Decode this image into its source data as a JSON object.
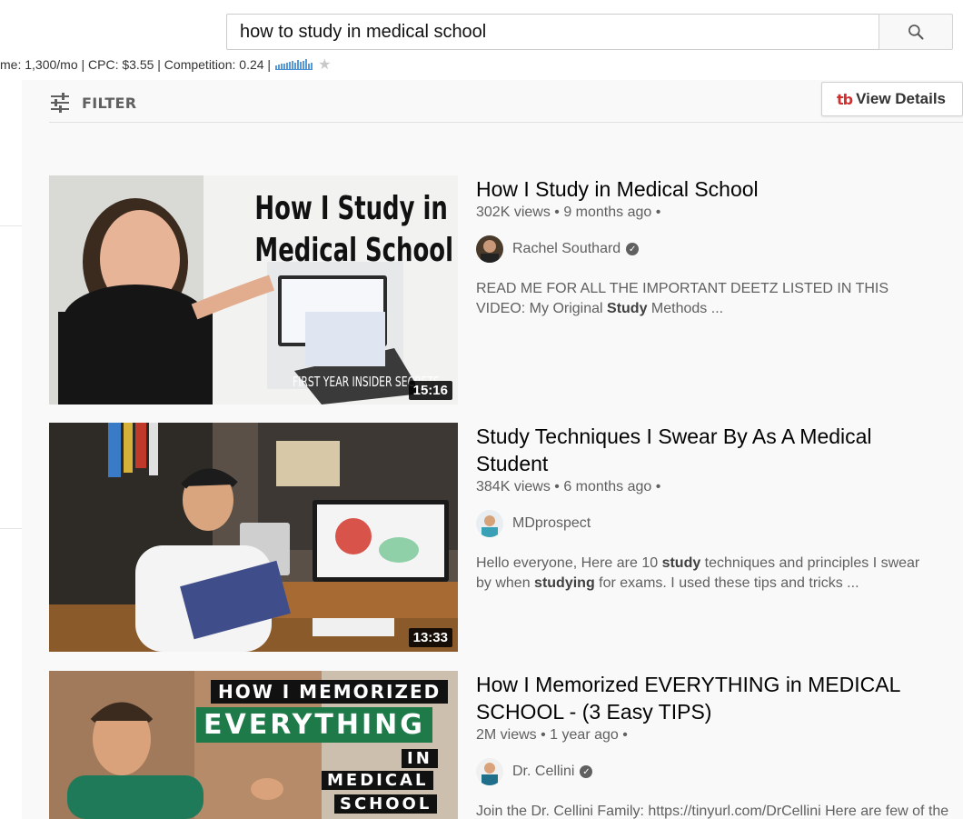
{
  "search": {
    "query": "how to study in medical school"
  },
  "keyword_stats": {
    "text": "me: 1,300/mo | CPC: $3.55 | Competition: 0.24 |",
    "trend_bars": [
      4,
      5,
      6,
      6,
      7,
      8,
      9,
      7,
      10,
      8,
      9,
      11,
      6,
      7
    ],
    "star": "★"
  },
  "filter": {
    "label": "FILTER"
  },
  "view_details": {
    "logo": "tb",
    "label": "View Details"
  },
  "colors": {
    "brand_red": "#d32f2f",
    "bar_blue": "#5b9bd5",
    "bg_main": "#f9f9f9"
  },
  "results": [
    {
      "title": "How I Study in Medical School",
      "meta": "302K views • 9 months ago •",
      "channel": "Rachel Southard",
      "verified": true,
      "desc_parts": [
        {
          "t": "READ ME FOR ALL THE IMPORTANT DEETZ LISTED IN THIS VIDEO: My Original ",
          "b": false
        },
        {
          "t": "Study",
          "b": true
        },
        {
          "t": " Methods ...",
          "b": false
        }
      ],
      "duration": "15:16",
      "thumb_text": [
        "How I Study in",
        "Medical School"
      ],
      "thumb_caption": "FIRST YEAR INSIDER SECRETS"
    },
    {
      "title": "Study Techniques I Swear By As A Medical Student",
      "meta": "384K views • 6 months ago •",
      "channel": "MDprospect",
      "verified": false,
      "desc_parts": [
        {
          "t": "Hello everyone, Here are 10 ",
          "b": false
        },
        {
          "t": "study",
          "b": true
        },
        {
          "t": " techniques and principles I swear by when ",
          "b": false
        },
        {
          "t": "studying",
          "b": true
        },
        {
          "t": " for exams. I used these tips and tricks ...",
          "b": false
        }
      ],
      "duration": "13:33"
    },
    {
      "title": "How I Memorized EVERYTHING in MEDICAL SCHOOL - (3 Easy TIPS)",
      "meta": "2M views • 1 year ago •",
      "channel": "Dr. Cellini",
      "verified": true,
      "desc_parts": [
        {
          "t": "Join the Dr. Cellini Family: https://tinyurl.com/DrCellini Here are few of the",
          "b": false
        }
      ],
      "duration": "",
      "thumb_text": [
        "HOW I MEMORIZED",
        "EVERYTHING",
        "IN",
        "MEDICAL",
        "SCHOOL"
      ]
    }
  ]
}
